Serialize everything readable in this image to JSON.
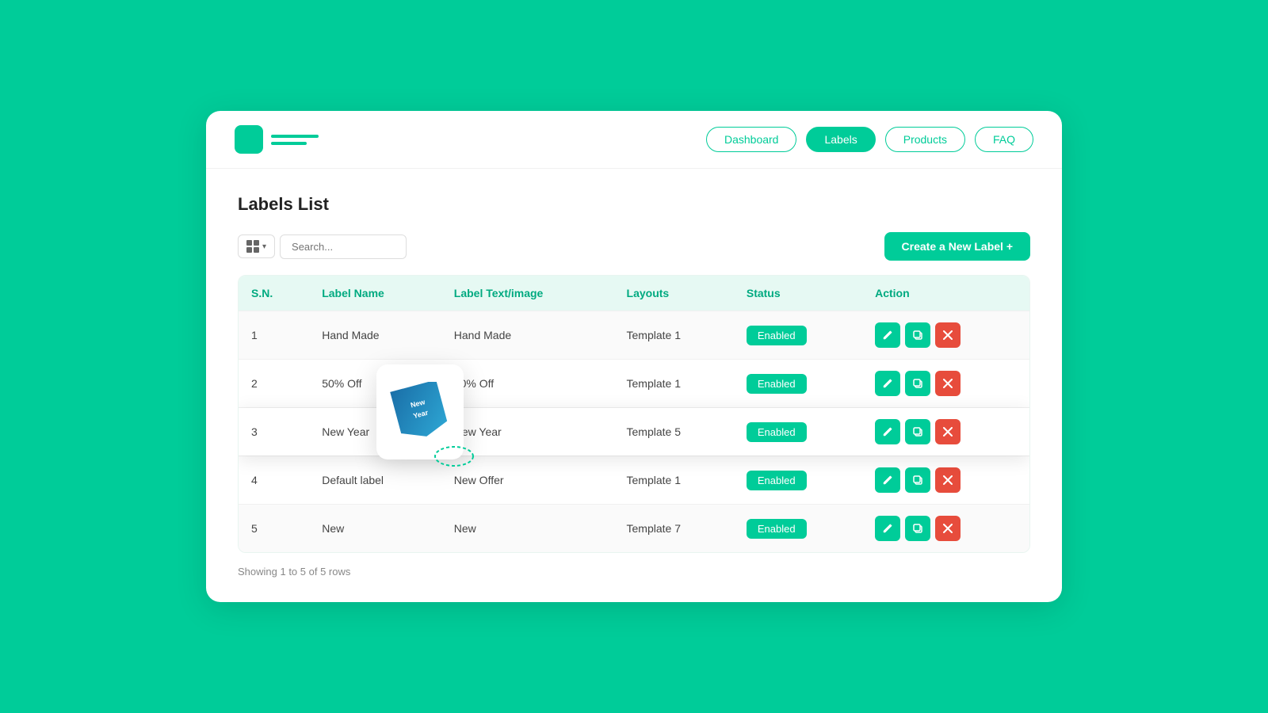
{
  "nav": {
    "tabs": [
      {
        "label": "Dashboard",
        "active": false
      },
      {
        "label": "Labels",
        "active": true
      },
      {
        "label": "Products",
        "active": false
      },
      {
        "label": "FAQ",
        "active": false
      }
    ]
  },
  "page": {
    "title": "Labels List",
    "search_placeholder": "Search...",
    "create_btn": "Create a New Label +",
    "footer": "Showing 1 to 5 of 5 rows"
  },
  "table": {
    "headers": [
      "S.N.",
      "Label Name",
      "Label Text/image",
      "Layouts",
      "Status",
      "Action"
    ],
    "rows": [
      {
        "sn": "1",
        "name": "Hand Made",
        "text": "Hand Made",
        "layout": "Template 1",
        "status": "Enabled"
      },
      {
        "sn": "2",
        "name": "50% Off",
        "text": "50% Off",
        "layout": "Template 1",
        "status": "Enabled"
      },
      {
        "sn": "3",
        "name": "New Year",
        "text": "New Year",
        "layout": "Template 5",
        "status": "Enabled",
        "highlighted": true
      },
      {
        "sn": "4",
        "name": "Default label",
        "text": "New  Offer",
        "layout": "Template 1",
        "status": "Enabled"
      },
      {
        "sn": "5",
        "name": "New",
        "text": "New",
        "layout": "Template 7",
        "status": "Enabled"
      }
    ]
  },
  "label_preview": {
    "text": "New Year"
  },
  "icons": {
    "edit": "✎",
    "copy": "⧉",
    "delete": "✕",
    "chevron": "▾"
  }
}
